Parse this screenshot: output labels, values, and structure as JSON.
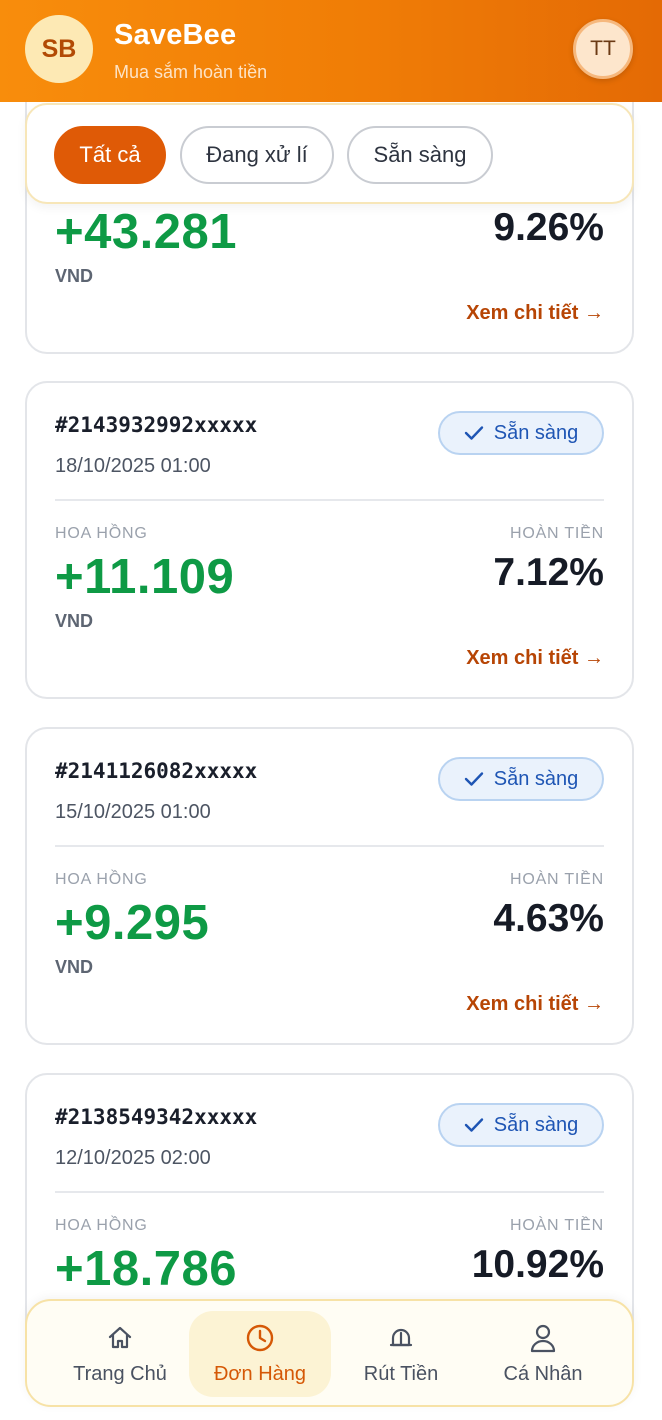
{
  "header": {
    "logo": "SB",
    "title": "SaveBee",
    "subtitle": "Mua sắm hoàn tiền",
    "avatar": "TT",
    "gradient_start": "#f88d0c",
    "gradient_end": "#e46a05"
  },
  "filters": [
    {
      "label": "Tất cả",
      "active": true
    },
    {
      "label": "Đang xử lí",
      "active": false
    },
    {
      "label": "Sẵn sàng",
      "active": false
    }
  ],
  "orders": [
    {
      "id": "",
      "date": "",
      "status": "",
      "commission_label": "",
      "refund_label": "",
      "commission": "+43.281",
      "currency": "VND",
      "refund": "9.26%",
      "detail": "Xem chi tiết →"
    },
    {
      "id": "#2143932992xxxxx",
      "date": "18/10/2025 01:00",
      "status": "Sẵn sàng",
      "commission_label": "HOA HỒNG",
      "refund_label": "HOÀN TIỀN",
      "commission": "+11.109",
      "currency": "VND",
      "refund": "7.12%",
      "detail": "Xem chi tiết →"
    },
    {
      "id": "#2141126082xxxxx",
      "date": "15/10/2025 01:00",
      "status": "Sẵn sàng",
      "commission_label": "HOA HỒNG",
      "refund_label": "HOÀN TIỀN",
      "commission": "+9.295",
      "currency": "VND",
      "refund": "4.63%",
      "detail": "Xem chi tiết →"
    },
    {
      "id": "#2138549342xxxxx",
      "date": "12/10/2025 02:00",
      "status": "Sẵn sàng",
      "commission_label": "HOA HỒNG",
      "refund_label": "HOÀN TIỀN",
      "commission": "+18.786",
      "currency": "",
      "refund": "10.92%",
      "detail": ""
    }
  ],
  "nav": [
    {
      "label": "Trang Chủ",
      "icon": "home-icon",
      "active": false
    },
    {
      "label": "Đơn Hàng",
      "icon": "clock-icon",
      "active": true
    },
    {
      "label": "Rút Tiền",
      "icon": "wallet-icon",
      "active": false
    },
    {
      "label": "Cá Nhân",
      "icon": "user-icon",
      "active": false
    }
  ],
  "colors": {
    "accent": "#df5a06",
    "positive": "#0e9a45",
    "status_blue": "#1e55b4"
  }
}
